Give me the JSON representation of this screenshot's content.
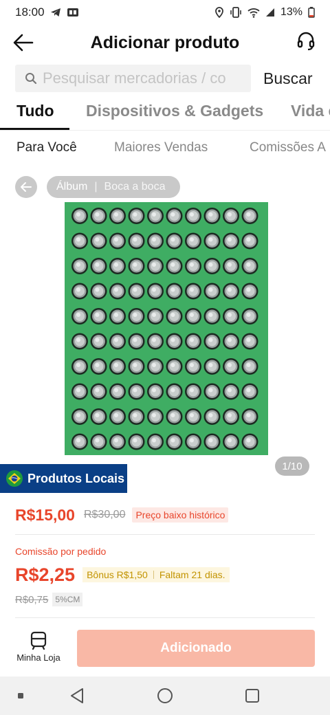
{
  "status_bar": {
    "time": "18:00",
    "battery": "13%"
  },
  "header": {
    "title": "Adicionar produto"
  },
  "search": {
    "placeholder": "Pesquisar mercadorias / co",
    "button_label": "Buscar"
  },
  "category_tabs": [
    {
      "label": "Tudo",
      "active": true
    },
    {
      "label": "Dispositivos & Gadgets",
      "active": false
    },
    {
      "label": "Vida e",
      "active": false
    }
  ],
  "sub_tabs": [
    {
      "label": "Para Você",
      "active": true
    },
    {
      "label": "Maiores Vendas",
      "active": false
    },
    {
      "label": "Comissões A",
      "active": false
    }
  ],
  "album": {
    "album_label": "Álbum",
    "separator": "|",
    "reviews_label": "Boca a boca"
  },
  "image_counter": "1/10",
  "local_badge": {
    "label": "Produtos Locais"
  },
  "price": {
    "current": "R$15,00",
    "original": "R$30,00",
    "badge": "Preço baixo histórico"
  },
  "commission": {
    "label": "Comissão por pedido",
    "value": "R$2,25",
    "bonus": "Bônus R$1,50",
    "time_left": "Faltam 21 dias.",
    "original": "R$0,75",
    "rate": "5%CM"
  },
  "bottom": {
    "store_label": "Minha Loja",
    "add_label": "Adicionado"
  },
  "colors": {
    "accent": "#e8452b",
    "add_button_disabled": "#f9b8a6",
    "local_badge_bg": "#0a3f86",
    "board_green": "#3fad63"
  }
}
